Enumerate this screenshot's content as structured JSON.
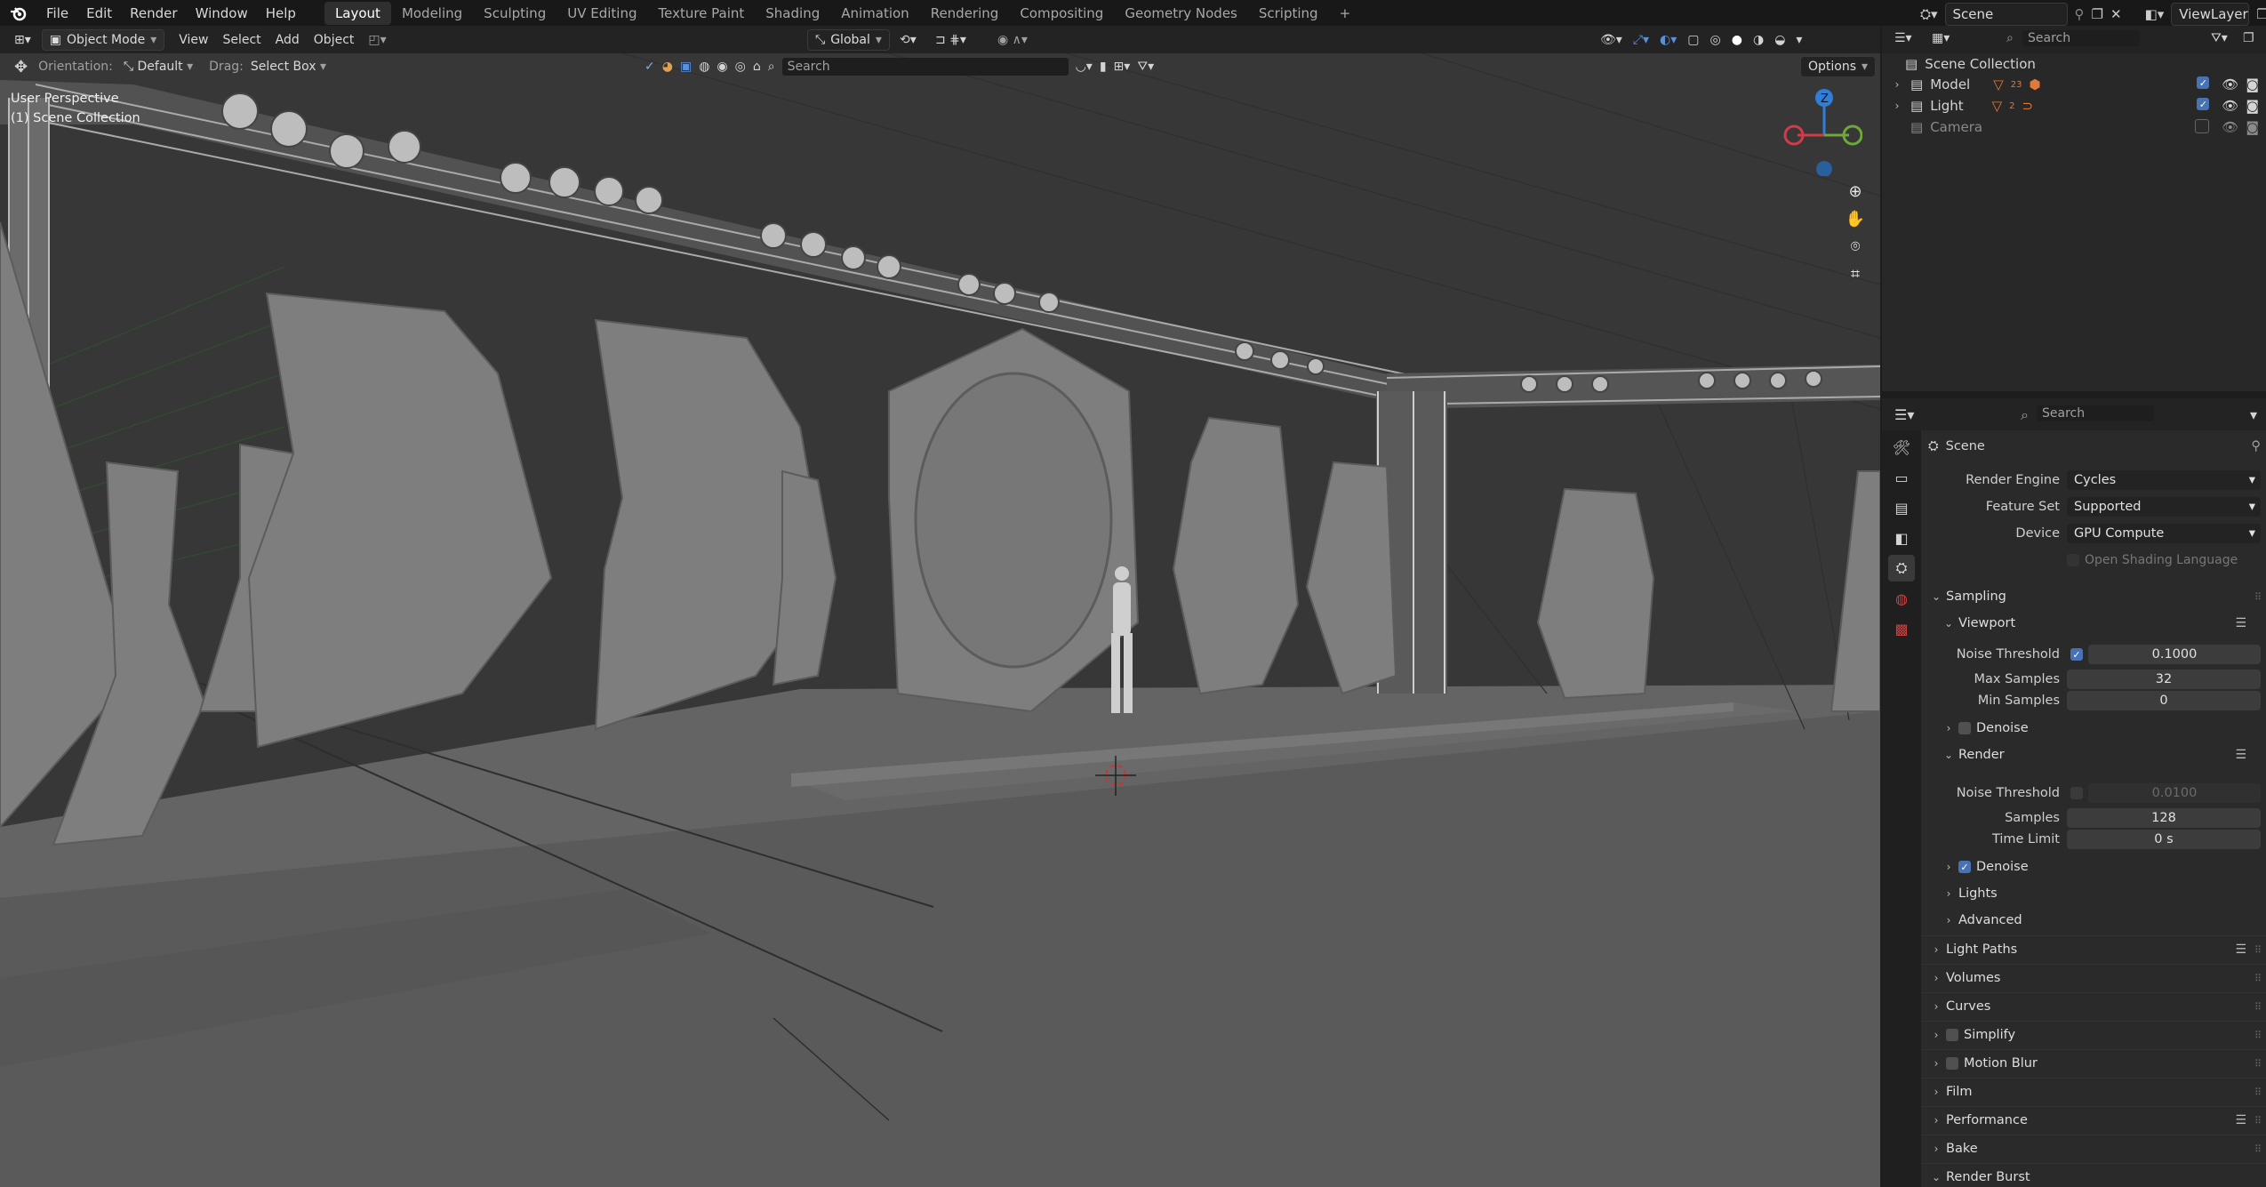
{
  "menu": [
    "File",
    "Edit",
    "Render",
    "Window",
    "Help"
  ],
  "workspaces": [
    "Layout",
    "Modeling",
    "Sculpting",
    "UV Editing",
    "Texture Paint",
    "Shading",
    "Animation",
    "Rendering",
    "Compositing",
    "Geometry Nodes",
    "Scripting"
  ],
  "add_workspace": "+",
  "scene_name": "Scene",
  "view_layer": "ViewLayer",
  "viewport": {
    "mode": "Object Mode",
    "menus": [
      "View",
      "Select",
      "Add",
      "Object"
    ],
    "transform": "Global",
    "orientation_label": "Orientation:",
    "orientation_value": "Default",
    "drag_label": "Drag:",
    "drag_value": "Select Box",
    "search_placeholder": "Search",
    "options": "Options",
    "overlay_line1": "User Perspective",
    "overlay_line2": "(1) Scene Collection",
    "gizmo_z": "Z"
  },
  "outliner": {
    "search_placeholder": "Search",
    "root": "Scene Collection",
    "items": [
      {
        "name": "Model",
        "count": "23"
      },
      {
        "name": "Light",
        "count": "2"
      },
      {
        "name": "Camera",
        "count": ""
      }
    ]
  },
  "properties": {
    "search_placeholder": "Search",
    "title": "Scene",
    "render_engine_label": "Render Engine",
    "render_engine": "Cycles",
    "feature_set_label": "Feature Set",
    "feature_set": "Supported",
    "device_label": "Device",
    "device": "GPU Compute",
    "osl_label": "Open Shading Language",
    "sampling": "Sampling",
    "viewport_section": "Viewport",
    "vp_noise_threshold_label": "Noise Threshold",
    "vp_noise_threshold": "0.1000",
    "vp_max_samples_label": "Max Samples",
    "vp_max_samples": "32",
    "vp_min_samples_label": "Min Samples",
    "vp_min_samples": "0",
    "vp_denoise": "Denoise",
    "render_section": "Render",
    "r_noise_threshold_label": "Noise Threshold",
    "r_noise_threshold": "0.0100",
    "r_samples_label": "Samples",
    "r_samples": "128",
    "r_time_limit_label": "Time Limit",
    "r_time_limit": "0 s",
    "r_denoise": "Denoise",
    "lights": "Lights",
    "advanced": "Advanced",
    "panels": [
      "Light Paths",
      "Volumes",
      "Curves",
      "Simplify",
      "Motion Blur",
      "Film",
      "Performance",
      "Bake",
      "Render Burst"
    ]
  },
  "colors": {
    "accent": "#4772b3",
    "viewport_bg": "#3b3b3b"
  }
}
